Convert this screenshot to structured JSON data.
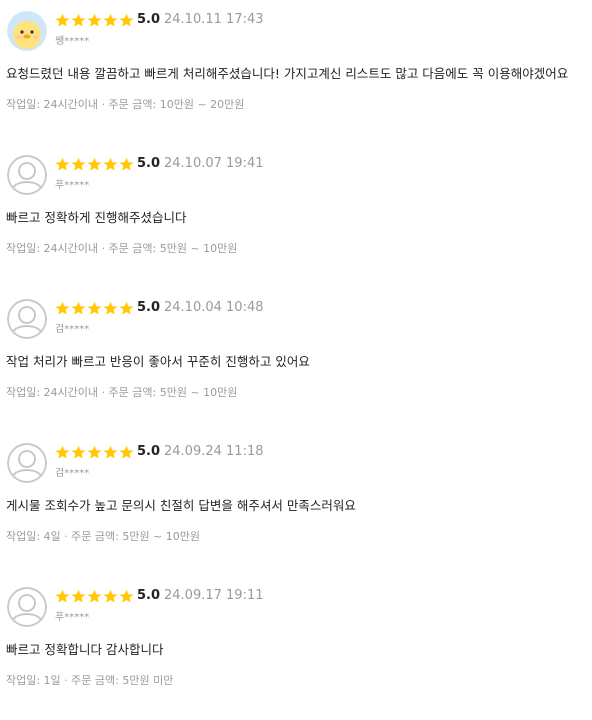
{
  "colors": {
    "star": "#FFC800",
    "muted": "#9a9a9a",
    "text": "#222222"
  },
  "reviews": [
    {
      "avatar": "duck-avatar-icon",
      "rating": 5,
      "score": "5.0",
      "date": "24.10.11 17:43",
      "user": "쌩*****",
      "text": "요청드렸던 내용 깔끔하고 빠르게 처리해주셨습니다! 가지고계신 리스트도 많고 다음에도 꼭 이용해야겠어요",
      "meta": "작업일: 24시간이내 · 주문 금액: 10만원 ~ 20만원"
    },
    {
      "avatar": "default-user-avatar-icon",
      "rating": 5,
      "score": "5.0",
      "date": "24.10.07 19:41",
      "user": "푸*****",
      "text": "빠르고 정확하게 진행해주셨습니다",
      "meta": "작업일: 24시간이내 · 주문 금액: 5만원 ~ 10만원"
    },
    {
      "avatar": "default-user-avatar-icon",
      "rating": 5,
      "score": "5.0",
      "date": "24.10.04 10:48",
      "user": "검*****",
      "text": "작업 처리가 빠르고 반응이 좋아서 꾸준히 진행하고 있어요",
      "meta": "작업일: 24시간이내 · 주문 금액: 5만원 ~ 10만원"
    },
    {
      "avatar": "default-user-avatar-icon",
      "rating": 5,
      "score": "5.0",
      "date": "24.09.24 11:18",
      "user": "검*****",
      "text": "게시물 조회수가 높고 문의시 친절히 답변을 해주셔서 만족스러워요",
      "meta": "작업일: 4일 · 주문 금액: 5만원 ~ 10만원"
    },
    {
      "avatar": "default-user-avatar-icon",
      "rating": 5,
      "score": "5.0",
      "date": "24.09.17 19:11",
      "user": "푸*****",
      "text": "빠르고 정확합니다 감사합니다",
      "meta": "작업일: 1일 · 주문 금액: 5만원 미만"
    }
  ]
}
